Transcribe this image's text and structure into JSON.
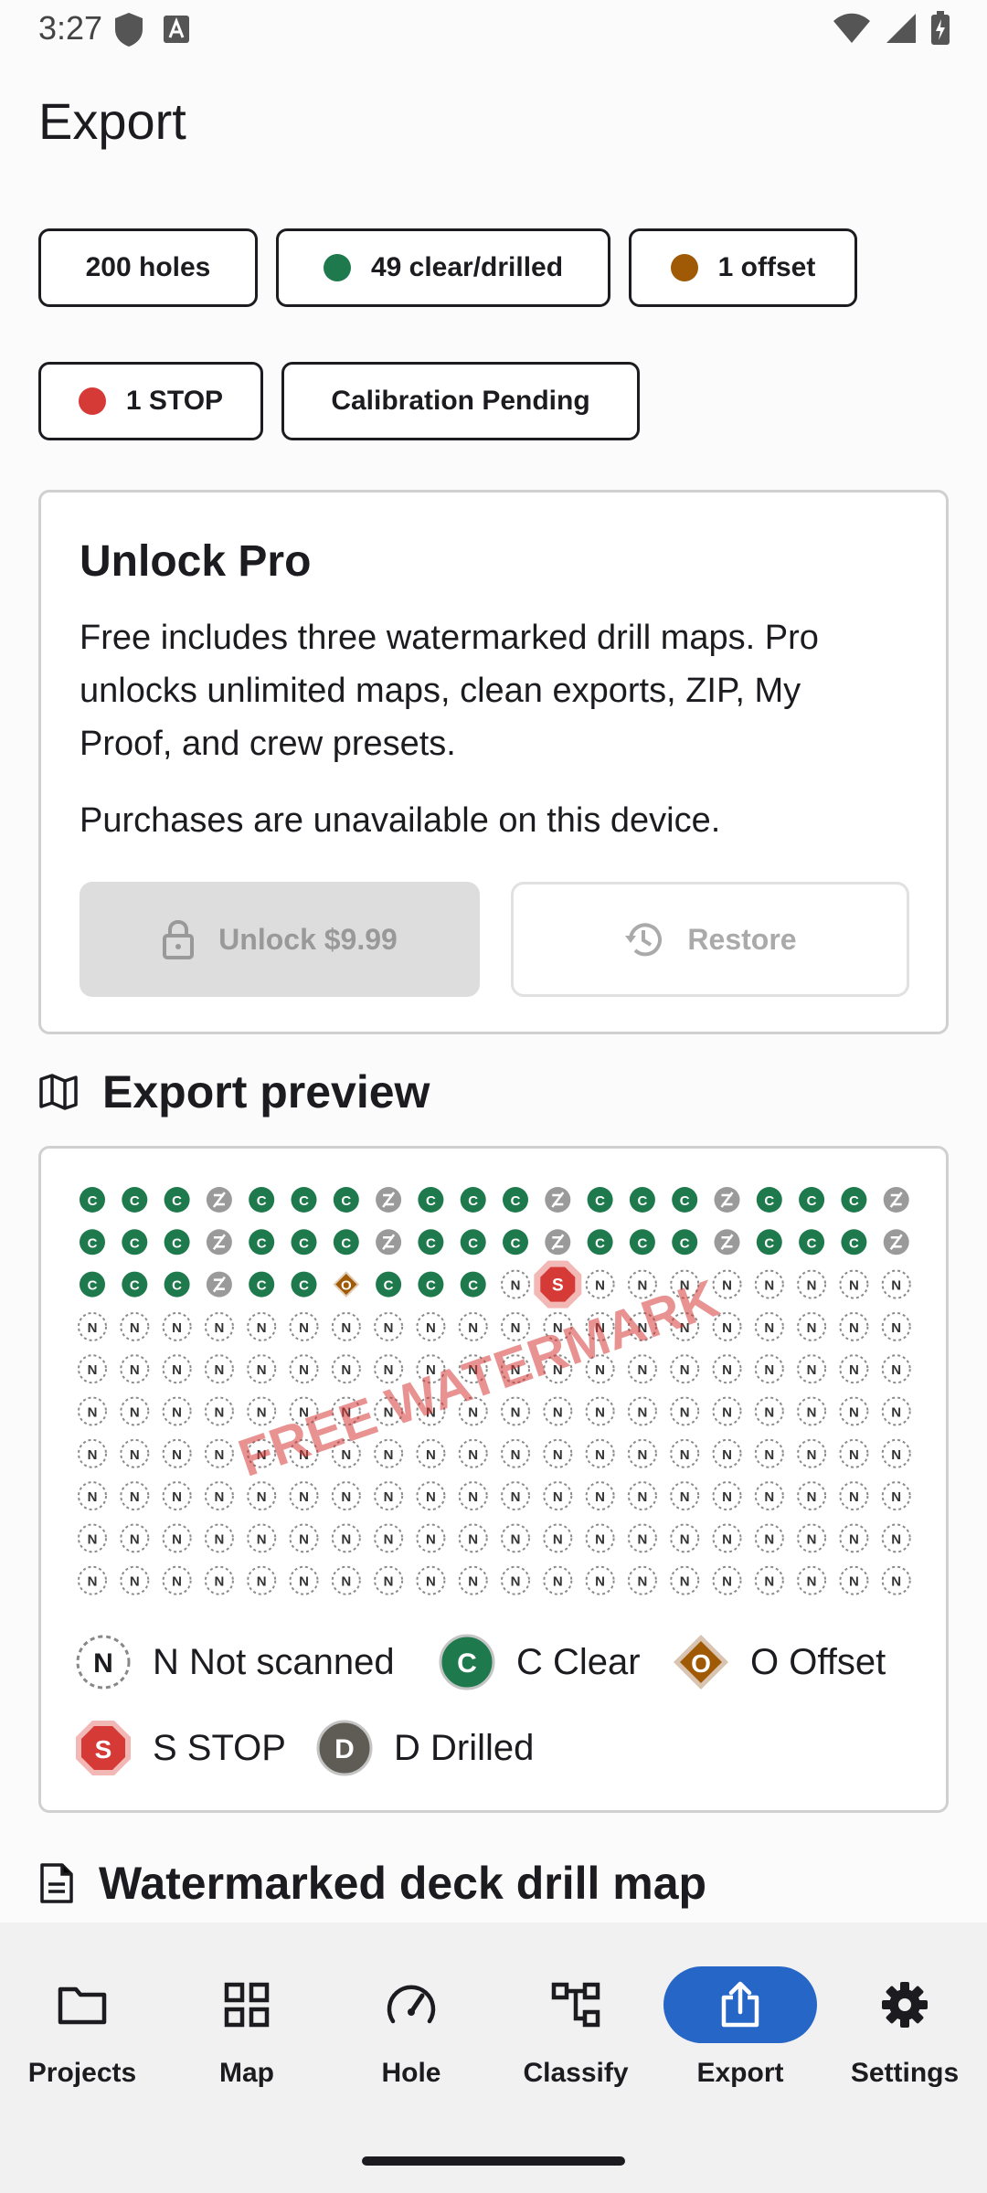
{
  "status_bar": {
    "time": "3:27"
  },
  "page_title": "Export",
  "summary_chips": [
    {
      "label": "200 holes",
      "dot_color": ""
    },
    {
      "label": "49 clear/drilled",
      "dot_color": "#1e7a4c"
    },
    {
      "label": "1 offset",
      "dot_color": "#a05a06"
    },
    {
      "label": "1 STOP",
      "dot_color": "#d63a36"
    },
    {
      "label": "Calibration Pending",
      "dot_color": ""
    }
  ],
  "pro_card": {
    "title": "Unlock Pro",
    "description": "Free includes three watermarked drill maps. Pro unlocks unlimited maps, clean exports, ZIP, My Proof, and crew presets.",
    "note": "Purchases are unavailable on this device.",
    "unlock_label": "Unlock $9.99",
    "restore_label": "Restore"
  },
  "export_preview": {
    "heading": "Export preview",
    "watermark": "FREE WATERMARK",
    "grid": {
      "columns": 20,
      "rows": [
        "CCCDCCCDCCCDCCCDCCCD",
        "CCCDCCCDCCCDCCCDCCCD",
        "CCCDCCOCCCNSNNNNNNNN",
        "NNNNNNNNNNNNNNNNNNNN",
        "NNNNNNNNNNNNNNNNNNNN",
        "NNNNNNNNNNNNNNNNNNNN",
        "NNNNNNNNNNNNNNNNNNNN",
        "NNNNNNNNNNNNNNNNNNNN",
        "NNNNNNNNNNNNNNNNNNNN",
        "NNNNNNNNNNNNNNNNNNNN"
      ]
    },
    "legend": [
      {
        "code": "N",
        "label": "N Not scanned"
      },
      {
        "code": "C",
        "label": "C Clear"
      },
      {
        "code": "O",
        "label": "O Offset"
      },
      {
        "code": "S",
        "label": "S STOP"
      },
      {
        "code": "D",
        "label": "D Drilled"
      }
    ]
  },
  "next_section": {
    "heading": "Watermarked deck drill map"
  },
  "bottom_nav": {
    "items": [
      {
        "label": "Projects",
        "icon": "folder-icon",
        "active": false
      },
      {
        "label": "Map",
        "icon": "grid-icon",
        "active": false
      },
      {
        "label": "Hole",
        "icon": "speedometer-icon",
        "active": false
      },
      {
        "label": "Classify",
        "icon": "hierarchy-icon",
        "active": false
      },
      {
        "label": "Export",
        "icon": "share-icon",
        "active": true
      },
      {
        "label": "Settings",
        "icon": "gear-icon",
        "active": false
      }
    ]
  },
  "colors": {
    "clear": "#1e7a4c",
    "drilled": "#9a9a9a",
    "offset": "#a05a06",
    "stop": "#d63a36",
    "active_nav": "#2566c6"
  }
}
